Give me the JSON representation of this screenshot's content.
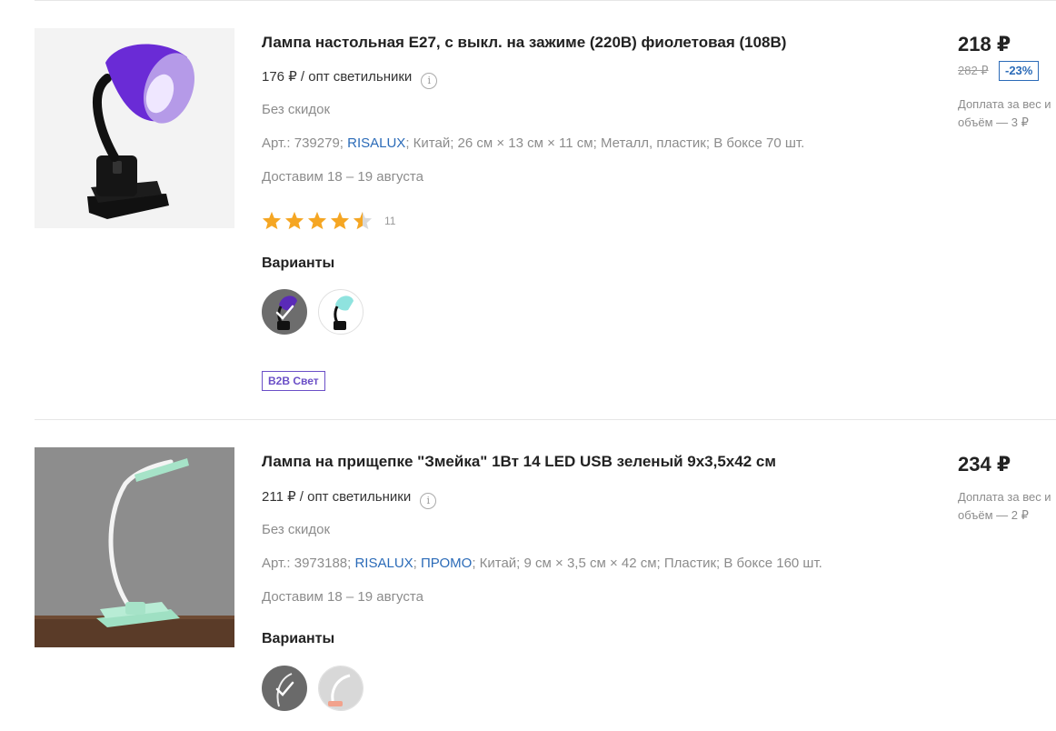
{
  "products": [
    {
      "title": "Лампа настольная Е27, с выкл. на зажиме (220В) фиолетовая (108В)",
      "wholesale_price": "176 ₽ / опт светильники",
      "discount_note": "Без скидок",
      "specs": {
        "art_prefix": "Арт.: 739279; ",
        "brand": "RISALUX",
        "rest": "; Китай; 26 см × 13 см × 11 см; Металл, пластик; В боксе 70 шт."
      },
      "delivery": "Доставим 18 – 19 августа",
      "rating": {
        "stars": 4.5,
        "count": "11"
      },
      "variants_label": "Варианты",
      "variants": [
        {
          "color": "purple",
          "selected": true
        },
        {
          "color": "mint",
          "selected": false
        }
      ],
      "badge": "B2B Свет",
      "price": "218 ₽",
      "old_price": "282 ₽",
      "discount": "-23%",
      "surcharge": "Доплата за вес и объём — 3 ₽",
      "color": "#7b3fe0"
    },
    {
      "title": "Лампа на прищепке \"Змейка\" 1Вт 14 LED USB зеленый 9х3,5х42 см",
      "wholesale_price": "211 ₽ / опт светильники",
      "discount_note": "Без скидок",
      "specs": {
        "art_prefix": "Арт.: 3973188; ",
        "brand": "RISALUX",
        "sep": "; ",
        "promo": "ПРОМО",
        "rest": "; Китай; 9 см × 3,5 см × 42 см; Пластик; В боксе 160 шт."
      },
      "delivery": "Доставим 18 – 19 августа",
      "variants_label": "Варианты",
      "variants": [
        {
          "color": "mint",
          "selected": true
        },
        {
          "color": "white",
          "selected": false
        }
      ],
      "price": "234 ₽",
      "surcharge": "Доплата за вес и объём — 2 ₽",
      "color": "#a6e3c8"
    }
  ],
  "colors": {
    "link": "#2b6bb8",
    "badge": "#6b4fc7",
    "star": "#f5a623",
    "muted": "#8c8c8c"
  },
  "icons": {
    "info": "info-icon",
    "star": "star-icon",
    "check": "check-icon"
  }
}
